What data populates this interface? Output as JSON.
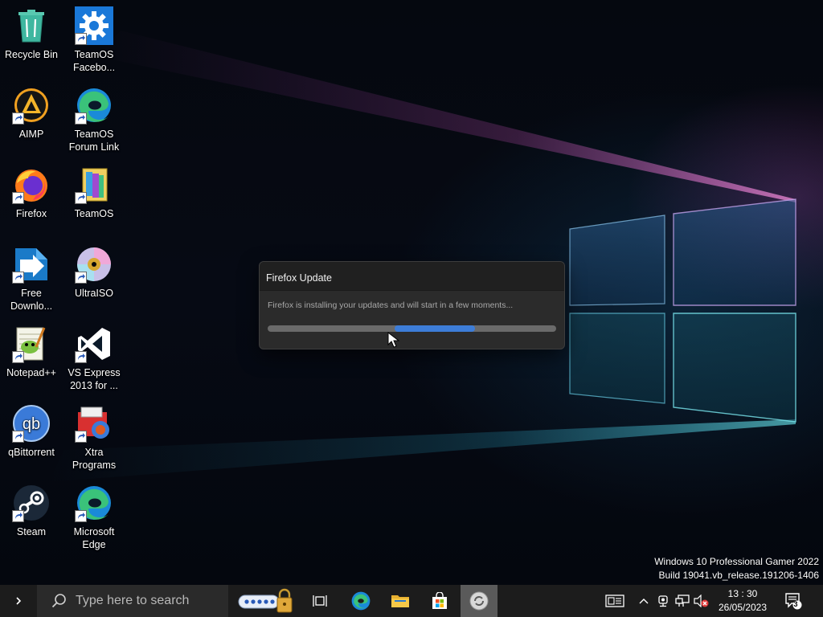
{
  "desktop": {
    "icons": [
      {
        "label": "Recycle Bin",
        "icon": "recycle-bin-icon"
      },
      {
        "label": "TeamOS Facebo...",
        "icon": "settings-gear-icon"
      },
      {
        "label": "AIMP",
        "icon": "aimp-icon"
      },
      {
        "label": "TeamOS Forum Link",
        "icon": "edge-icon"
      },
      {
        "label": "Firefox",
        "icon": "firefox-icon"
      },
      {
        "label": "TeamOS",
        "icon": "teamos-folder-icon"
      },
      {
        "label": "Free Downlo...",
        "icon": "free-download-manager-icon"
      },
      {
        "label": "UltraISO",
        "icon": "ultraiso-disc-icon"
      },
      {
        "label": "Notepad++",
        "icon": "notepad-plus-plus-icon"
      },
      {
        "label": "VS Express 2013 for ...",
        "icon": "visual-studio-icon"
      },
      {
        "label": "qBittorrent",
        "icon": "qbittorrent-icon"
      },
      {
        "label": "Xtra Programs",
        "icon": "xtra-programs-icon"
      },
      {
        "label": "Steam",
        "icon": "steam-icon"
      },
      {
        "label": "Microsoft Edge",
        "icon": "edge-icon"
      }
    ]
  },
  "dialog": {
    "title": "Firefox Update",
    "message": "Firefox is installing your updates and will start in a few moments...",
    "progress_state": "indeterminate"
  },
  "watermark": {
    "line1": "Windows 10 Professional Gamer 2022",
    "line2": "Build 19041.vb_release.191206-1406"
  },
  "taskbar": {
    "start_icon": "chevron-right-icon",
    "search_placeholder": "Type here to search",
    "pinned": [
      {
        "name": "password-lock-icon"
      },
      {
        "name": "task-view-icon"
      },
      {
        "name": "edge-icon"
      },
      {
        "name": "file-explorer-icon"
      },
      {
        "name": "microsoft-store-icon"
      },
      {
        "name": "firefox-updater-icon",
        "active": true
      }
    ],
    "tray": {
      "news_icon": "news-icon",
      "overflow_icon": "chevron-up-icon",
      "icons": [
        "webcam-icon",
        "network-icon",
        "volume-muted-icon"
      ],
      "time": "13 : 30",
      "date": "26/05/2023",
      "notification_count": "3"
    }
  },
  "colors": {
    "accent_blue": "#3d7dd8",
    "taskbar_bg": "#1c1c1c",
    "dialog_bg": "#2b2b2b"
  }
}
